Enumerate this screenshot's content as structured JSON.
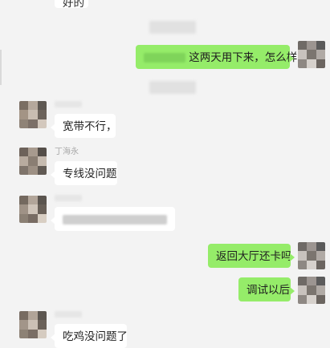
{
  "conversation": {
    "top_partial": "好的",
    "messages": [
      {
        "id": "m1",
        "side": "right",
        "text": "这两天用下来，怎么样"
      },
      {
        "id": "m2",
        "side": "left",
        "sender": "",
        "text": "宽带不行，"
      },
      {
        "id": "m3",
        "side": "left",
        "sender": "丁海永",
        "text": "专线没问题"
      },
      {
        "id": "m4",
        "side": "left",
        "sender": "",
        "text": ""
      },
      {
        "id": "m5",
        "side": "right",
        "text": "返回大厅还卡吗"
      },
      {
        "id": "m6",
        "side": "right",
        "text": "调试以后"
      },
      {
        "id": "m7",
        "side": "left",
        "sender": "",
        "text": "吃鸡没问题了"
      }
    ]
  },
  "colors": {
    "background": "#f3f3f3",
    "bubble_left": "#ffffff",
    "bubble_right": "#95ec69",
    "sender_name": "#a8a8a8"
  },
  "icons": {
    "avatar": "avatar-icon"
  }
}
